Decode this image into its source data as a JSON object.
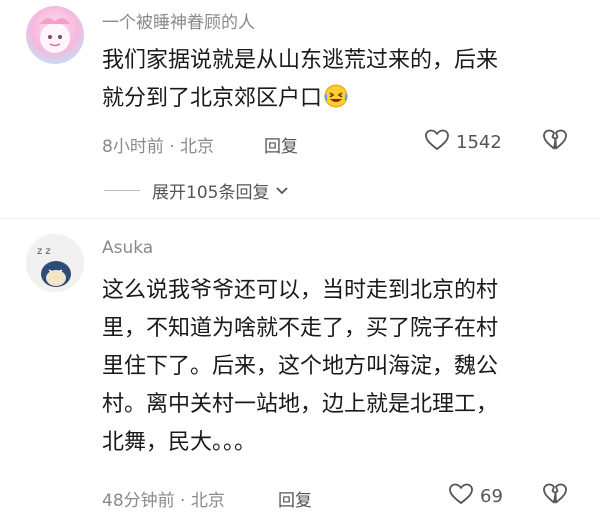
{
  "comments": [
    {
      "username": "一个被睡神眷顾的人",
      "lines": [
        "我们家据说就是从山东逃荒过来的，后来",
        "就分到了北京郊区户口"
      ],
      "emoji_icon": "rolling-laughing-emoji-icon",
      "meta": "8小时前 · 北京",
      "reply_label": "回复",
      "likes": "1542",
      "expand_label": "展开105条回复"
    },
    {
      "username": "Asuka",
      "lines": [
        "这么说我爷爷还可以，当时走到北京的村",
        "里，不知道为啥就不走了，买了院子在村",
        "里住下了。后来，这个地方叫海淀，魏公",
        "村。离中关村一站地，边上就是北理工，",
        "北舞，民大。。。"
      ],
      "meta": "48分钟前 · 北京",
      "reply_label": "回复",
      "likes": "69"
    }
  ],
  "colors": {
    "meta": "#8a8a8a",
    "text": "#1a1a1a",
    "icon": "#555555"
  }
}
